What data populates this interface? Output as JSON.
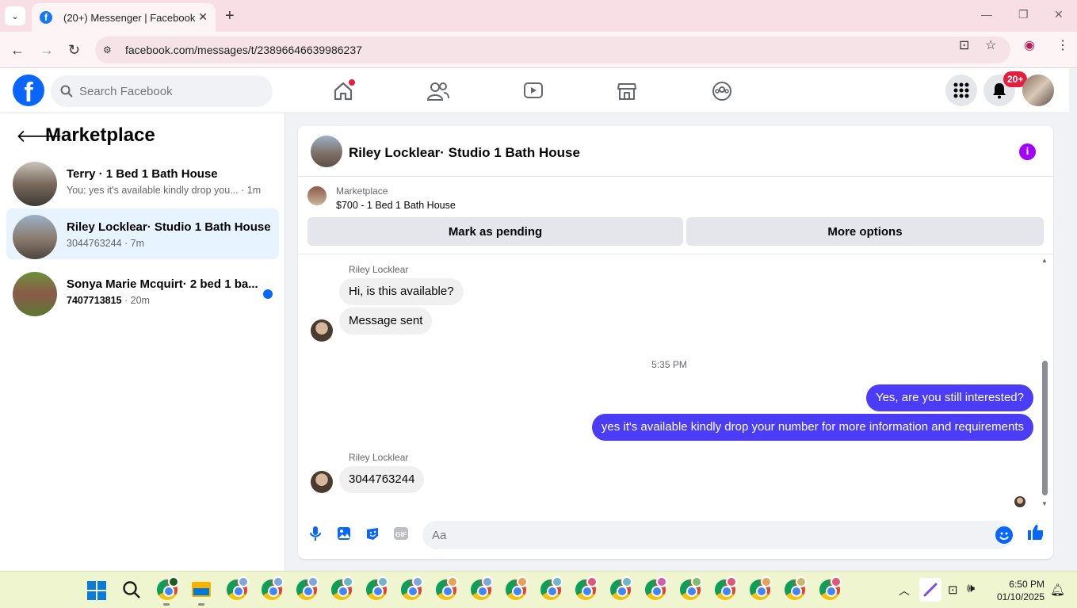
{
  "browser": {
    "tab_title": "(20+) Messenger | Facebook",
    "url": "facebook.com/messages/t/23896646639986237"
  },
  "fb": {
    "search_placeholder": "Search Facebook",
    "notif_badge": "20+"
  },
  "sidebar": {
    "title": "Marketplace",
    "conversations": [
      {
        "name": "Terry · 1 Bed 1 Bath House",
        "preview": "You: yes it's available kindly drop you...",
        "time": " · 1m",
        "unread": false,
        "active": false
      },
      {
        "name": "Riley Locklear· Studio 1 Bath House",
        "preview": "3044763244",
        "time": " · 7m",
        "unread": false,
        "active": true
      },
      {
        "name": "Sonya Marie Mcquirt· 2 bed 1 ba...",
        "preview": "7407713815",
        "time": " · 20m",
        "unread": true,
        "active": false
      }
    ]
  },
  "chat": {
    "title": "Riley Locklear· Studio 1 Bath House",
    "marketplace_label": "Marketplace",
    "listing": "$700 - 1 Bed 1 Bath House",
    "mark_pending": "Mark as pending",
    "more_options": "More options",
    "messages": {
      "sender1": "Riley Locklear",
      "in1": "Hi, is this available?",
      "in2": "Message sent",
      "timestamp": "5:35 PM",
      "out1": "Yes, are you still interested?",
      "out2": "yes it's available kindly drop your number for more information and requirements",
      "sender2": "Riley Locklear",
      "in3": "3044763244"
    },
    "composer_placeholder": "Aa"
  },
  "taskbar": {
    "time": "6:50 PM",
    "date": "01/10/2025"
  },
  "colors": {
    "fb_blue": "#0866ff",
    "outgoing_bubble": "#4b3cf7",
    "info_purple": "#a100ff"
  }
}
